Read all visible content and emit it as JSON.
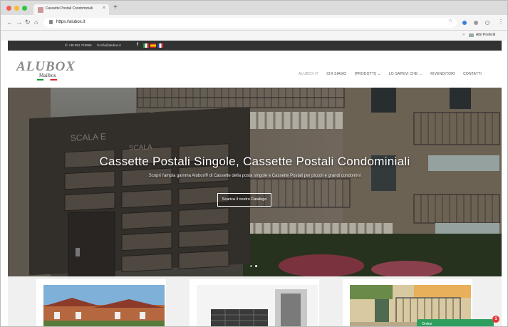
{
  "browser": {
    "tab_title": "Cassette Postali Condominiali",
    "tab_close": "×",
    "new_tab": "+",
    "url": "https://alubox.it",
    "bookmarks_folder": "Altri Preferiti",
    "icons": [
      "back-icon",
      "forward-icon",
      "reload-icon",
      "home-icon",
      "lock-icon",
      "star-icon",
      "menu-icon",
      "folder-icon"
    ]
  },
  "topbar": {
    "phone": "+39 051 743565",
    "email": "info@alubox.it",
    "facebook": "f",
    "flags": [
      "it",
      "es",
      "fr"
    ]
  },
  "header": {
    "logo_text": "ALUBOX",
    "logo_sub": "Mailbox",
    "nav": [
      {
        "label": "ALUBOX IT"
      },
      {
        "label": "CHI SIAMO"
      },
      {
        "label": "[PRODOTTI] ⌄"
      },
      {
        "label": "LO SAPEVI CHE ..."
      },
      {
        "label": "RIVENDITORI"
      },
      {
        "label": "CONTATTI"
      }
    ]
  },
  "hero": {
    "title": "Cassette Postali Singole, Cassette Postali Condominiali",
    "subtitle": "Scopri l'ampia gamma Alubox® di Cassette della posta singole e Cassette Postali per piccoli e grandi condomini",
    "button_label": "Scarica il nostro Catalogo",
    "mailbox_text_1": "SCALA E",
    "mailbox_text_2": "SCALA",
    "slider_dots": 2,
    "active_dot": 2
  },
  "chat": {
    "label": "Online",
    "badge": "1",
    "color": "#2e9e5e"
  },
  "colors": {
    "topbar_bg": "#323232",
    "accent_green": "#1a9a3a",
    "accent_red": "#d42a2a"
  }
}
